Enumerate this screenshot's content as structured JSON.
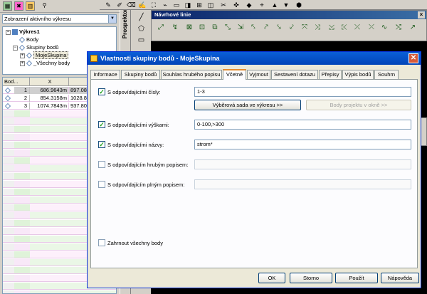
{
  "left_panel": {
    "view_combo": "Zobrazení aktivního výkresu",
    "tree": {
      "root": "Výkres1",
      "items": [
        "Body",
        "Skupiny bodů",
        "MojeSkupina",
        "_Všechny body"
      ]
    },
    "grid": {
      "headers": [
        "Bod...",
        "X"
      ],
      "rows": [
        {
          "num": "1",
          "x": "686.9643m",
          "y": "897.08"
        },
        {
          "num": "2",
          "x": "854.3158m",
          "y": "1028.83"
        },
        {
          "num": "3",
          "x": "1074.7843m",
          "y": "937.80"
        }
      ]
    }
  },
  "prospector_label": "Prospektor",
  "navrhove_linie": {
    "title": "Návrhové linie"
  },
  "dialog": {
    "title": "Vlastnosti skupiny bodů - MojeSkupina",
    "close_glyph": "✕",
    "tabs": [
      "Informace",
      "Skupiny bodů",
      "Souhlas hrubého popisu",
      "Včetně",
      "Vyjmout",
      "Sestavení dotazu",
      "Přepisy",
      "Výpis bodů",
      "Souhrn"
    ],
    "active_tab": "Včetně",
    "rows": {
      "numbers": {
        "label": "S odpovídajícími čísly:",
        "checked": true,
        "value": "1-3"
      },
      "elevations": {
        "label": "S odpovídajícími výškami:",
        "checked": true,
        "value": "0-100,>300"
      },
      "names": {
        "label": "S odpovídajícími názvy:",
        "checked": true,
        "value": "strom*"
      },
      "raw_desc": {
        "label": "S odpovídajícím hrubým popisem:",
        "checked": false,
        "value": ""
      },
      "full_desc": {
        "label": "S odpovídajícím plným popisem:",
        "checked": false,
        "value": ""
      },
      "include_all": {
        "label": "Zahrnout všechny body",
        "checked": false
      }
    },
    "select_in_drawing_button": "Výběrová sada ve výkresu >>",
    "project_points_button": "Body projektu v okně >>",
    "buttons": {
      "ok": "OK",
      "cancel": "Storno",
      "apply": "Použít",
      "help": "Nápověda"
    }
  }
}
